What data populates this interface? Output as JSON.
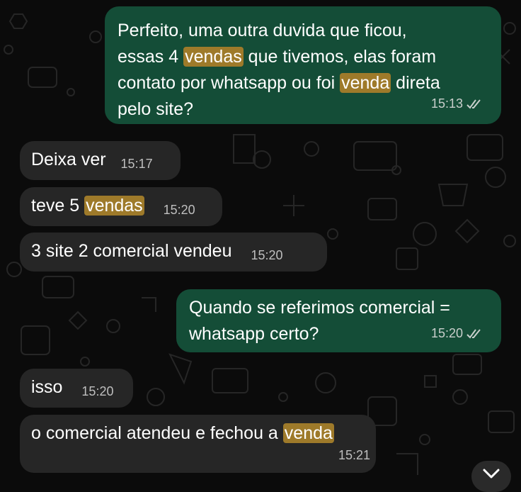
{
  "chat": {
    "messages": [
      {
        "direction": "outgoing",
        "lines": [
          [
            "Perfeito, uma outra duvida que ficou,"
          ],
          [
            "essas 4 ",
            "vendas",
            " que tivemos, elas foram"
          ],
          [
            "contato por whatsapp ou foi ",
            "venda",
            " direta"
          ],
          [
            "pelo site?"
          ]
        ],
        "time": "15:13",
        "read_status": "read-double-check"
      },
      {
        "direction": "incoming",
        "text": "Deixa ver",
        "time": "15:17"
      },
      {
        "direction": "incoming",
        "text_before": "teve 5 ",
        "highlight": "vendas",
        "text_after": "",
        "time": "15:20"
      },
      {
        "direction": "incoming",
        "text": "3 site 2 comercial vendeu",
        "time": "15:20"
      },
      {
        "direction": "outgoing",
        "line1": "Quando se referimos comercial =",
        "line2": "whatsapp certo?",
        "time": "15:20",
        "read_status": "read-double-check"
      },
      {
        "direction": "incoming",
        "text": "isso",
        "time": "15:20"
      },
      {
        "direction": "incoming",
        "text_before": "o comercial atendeu e fechou a ",
        "highlight": "venda",
        "text_after": "",
        "time": "15:21"
      }
    ],
    "search_highlight_color": "#9e7a2a",
    "outgoing_color": "#144d37",
    "incoming_color": "#262626"
  },
  "controls": {
    "scroll_down_icon": "chevron-down-icon"
  }
}
